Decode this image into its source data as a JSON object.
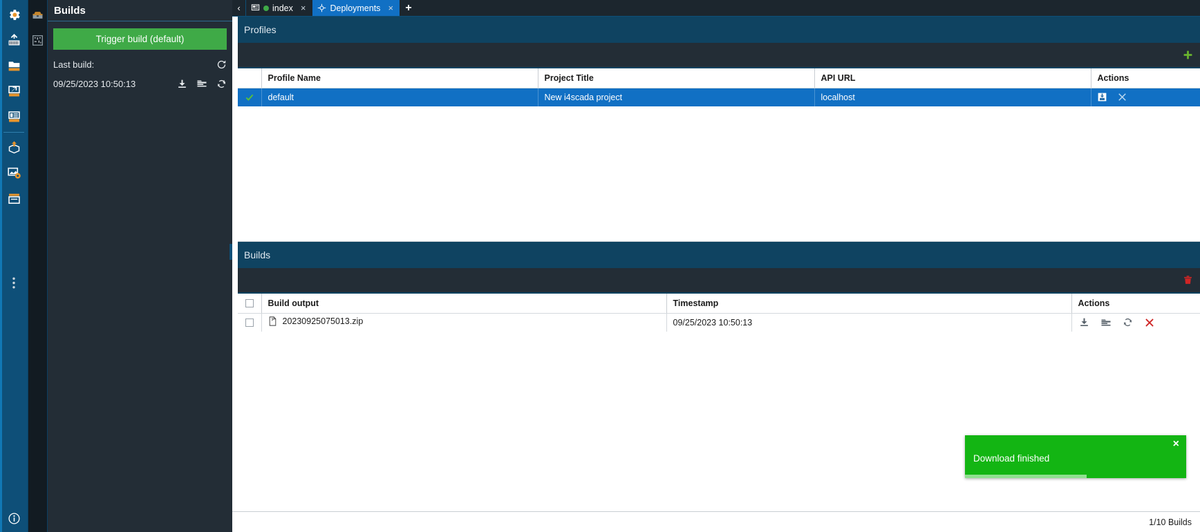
{
  "rail": {
    "items": [
      {
        "name": "settings-gear-icon",
        "label": "Settings"
      },
      {
        "name": "analytics-chart-icon",
        "label": "Analytics"
      },
      {
        "name": "folder-icon",
        "label": "Project"
      },
      {
        "name": "export-icon",
        "label": "Export"
      },
      {
        "name": "list-icon",
        "label": "Lists"
      },
      {
        "name": "deploy-package-icon",
        "label": "Deploy"
      },
      {
        "name": "image-settings-icon",
        "label": "Image Settings"
      },
      {
        "name": "archive-icon",
        "label": "Archive"
      }
    ],
    "more_label": "⋮",
    "info_label": "i"
  },
  "rail2": {
    "items": [
      {
        "name": "toolbox-icon",
        "label": "Toolbox"
      },
      {
        "name": "schematic-icon",
        "label": "Schematic"
      }
    ]
  },
  "dock": {
    "title": "Builds",
    "trigger_button": "Trigger build (default)",
    "last_build_label": "Last build:",
    "last_build_timestamp": "09/25/2023 10:50:13",
    "refresh_icon": "refresh-icon",
    "row_icons": [
      "download-icon",
      "open-folder-icon",
      "restore-icon"
    ]
  },
  "tabs": {
    "back_arrow": "‹",
    "items": [
      {
        "label": "index",
        "active": false,
        "has_status_dot": true,
        "icon": "screen-icon",
        "close": "×"
      },
      {
        "label": "Deployments",
        "active": true,
        "has_status_dot": false,
        "icon": "deployments-icon",
        "close": "×"
      }
    ],
    "add_label": "+"
  },
  "profiles": {
    "title": "Profiles",
    "add_button_label": "+",
    "columns": [
      "Profile Name",
      "Project Title",
      "API URL",
      "Actions"
    ],
    "rows": [
      {
        "selected": true,
        "check_icon": "check-icon",
        "profile_name": "default",
        "project_title": "New i4scada project",
        "api_url": "localhost",
        "actions": [
          "save-icon",
          "close-x-icon"
        ]
      }
    ]
  },
  "builds": {
    "title": "Builds",
    "delete_button_label": "delete-icon",
    "columns": [
      "Build output",
      "Timestamp",
      "Actions"
    ],
    "rows": [
      {
        "checked": false,
        "file_icon": "zip-file-icon",
        "build_output": "20230925075013.zip",
        "timestamp": "09/25/2023 10:50:13",
        "actions": [
          "download-icon",
          "open-folder-icon",
          "restore-icon",
          "delete-x-icon"
        ]
      }
    ]
  },
  "toast": {
    "message": "Download finished",
    "close_label": "×",
    "progress_percent": 55
  },
  "status": {
    "builds_count": "1/10 Builds"
  },
  "colors": {
    "accent_blue": "#1170c4",
    "header_blue": "#0f4361",
    "rail_blue": "#0e4f78",
    "dark_panel": "#232d36",
    "green": "#3faa47",
    "toast_green": "#13b513",
    "red": "#d02626",
    "orange": "#e8952c"
  }
}
